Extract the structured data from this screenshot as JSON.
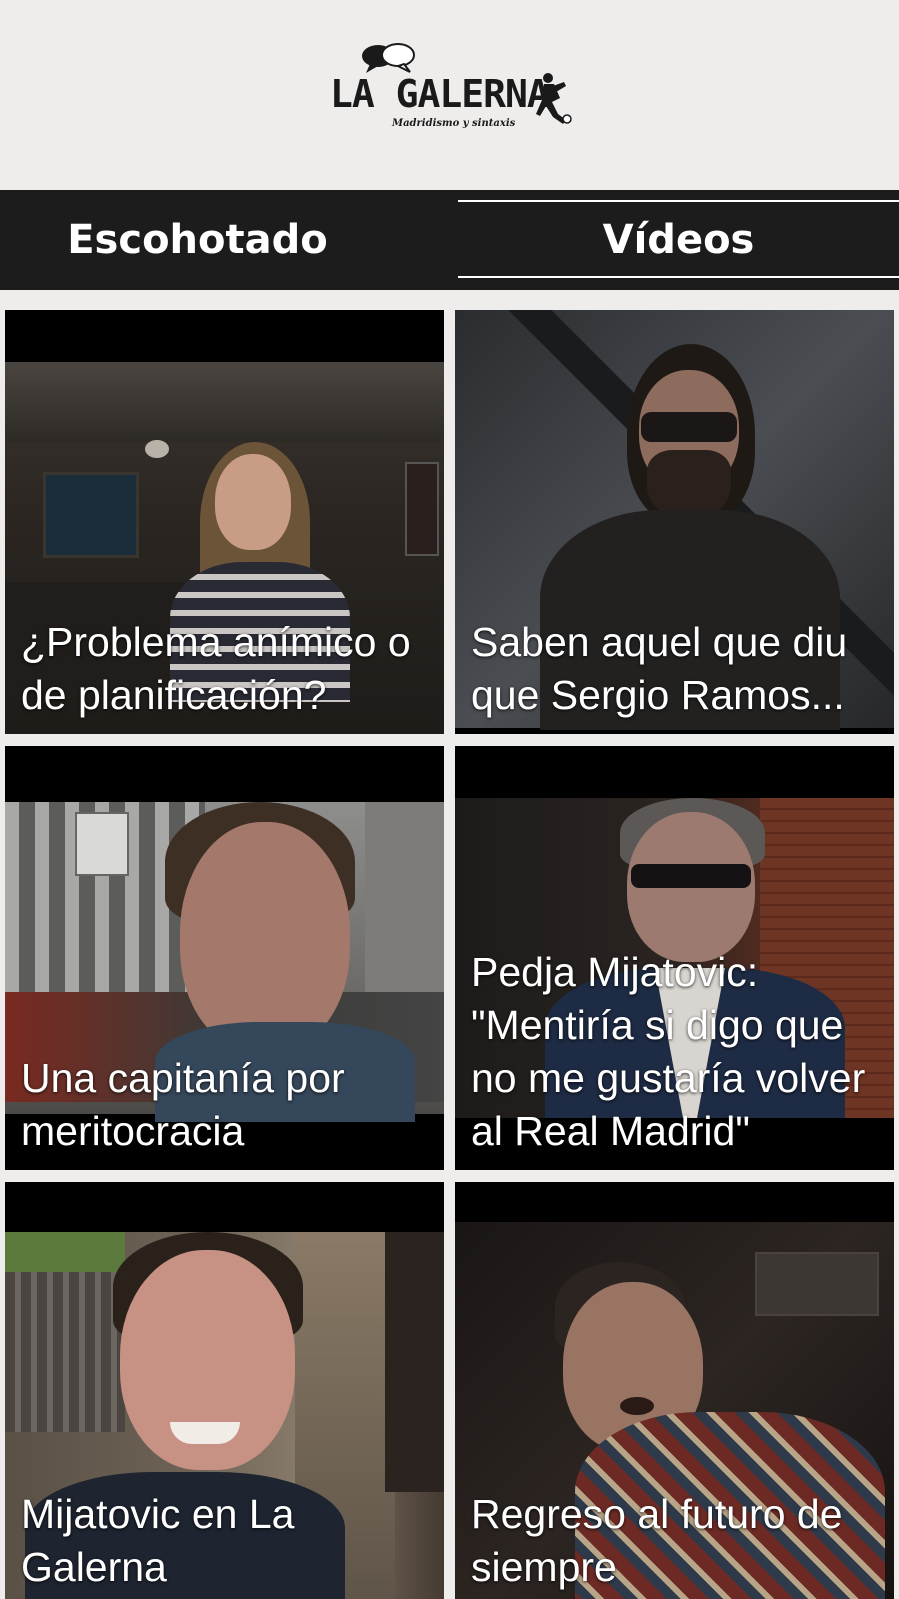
{
  "header": {
    "logo_text": "LA GALERNA",
    "logo_tagline": "Madridismo y sintaxis"
  },
  "tabs": [
    {
      "label": "Escohotado",
      "selected": false
    },
    {
      "label": "Vídeos",
      "selected": true
    }
  ],
  "videos": [
    {
      "title": "¿Problema anímico o de planificación?"
    },
    {
      "title": "Saben aquel que diu que Sergio Ramos..."
    },
    {
      "title": "Una capitanía por meritocracia"
    },
    {
      "title": "Pedja Mijatovic: \"Mentiría si digo que no me gustaría volver al Real Madrid\""
    },
    {
      "title": "Mijatovic en La Galerna"
    },
    {
      "title": "Regreso al futuro de siempre"
    }
  ],
  "colors": {
    "background": "#eeedeb",
    "tabbar": "#1c1c1c",
    "text_light": "#ffffff",
    "logo": "#1a1a1a"
  }
}
